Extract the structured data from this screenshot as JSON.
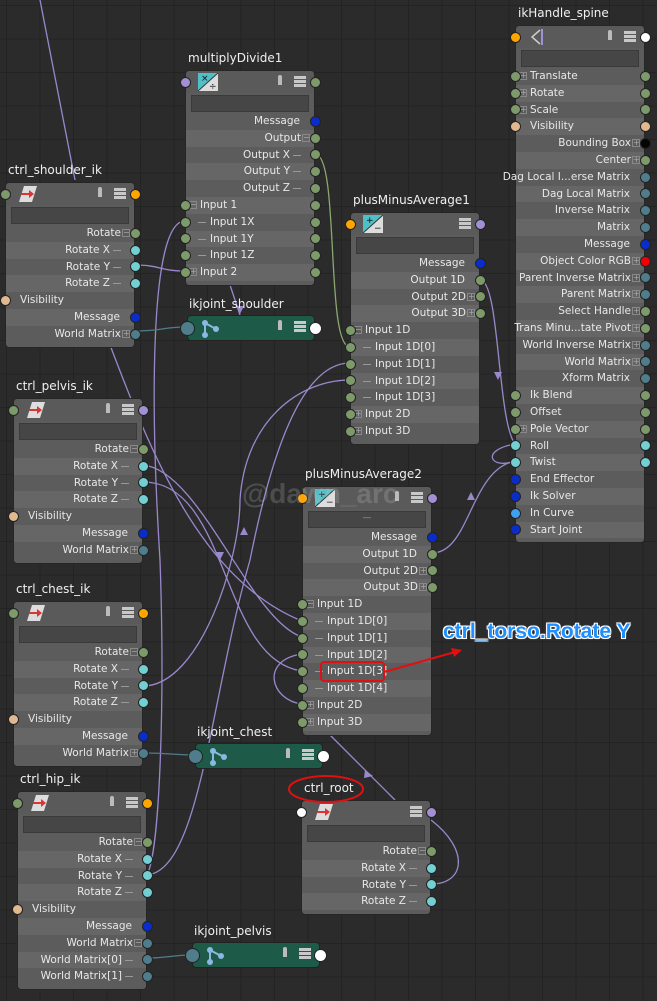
{
  "port_colors": {
    "green": "#7d9a6a",
    "teal": "#72cfd2",
    "blue": "#0a2cc8",
    "orange": "#ffa500",
    "purple": "#a28fd4",
    "tan": "#e0b990",
    "steel": "#4f7d8c",
    "black": "#050505",
    "red": "#f00000",
    "lightblue": "#3fa0f0",
    "white": "#ffffff"
  },
  "nodes": [
    {
      "id": "md1",
      "name": "multiplyDivide1",
      "icon": "multiply-divide",
      "hl": "purple",
      "hr": "green",
      "pin": true,
      "rows": [
        {
          "label": "Message",
          "a": "r",
          "r": "blue"
        },
        {
          "label": "Output",
          "a": "r",
          "x": "−",
          "r": "green"
        },
        {
          "label": "Output X",
          "a": "r",
          "c": 1,
          "r": "green"
        },
        {
          "label": "Output Y",
          "a": "r",
          "c": 1,
          "r": "green"
        },
        {
          "label": "Output Z",
          "a": "r",
          "c": 1,
          "r": "green"
        },
        {
          "label": "Input 1",
          "a": "l",
          "x": "−",
          "l": "green",
          "r": "green"
        },
        {
          "label": "Input 1X",
          "a": "l",
          "c": 1,
          "l": "green",
          "r": "green"
        },
        {
          "label": "Input 1Y",
          "a": "l",
          "c": 1,
          "l": "green",
          "r": "green"
        },
        {
          "label": "Input 1Z",
          "a": "l",
          "c": 1,
          "l": "green",
          "r": "green"
        },
        {
          "label": "Input 2",
          "a": "l",
          "x": "+",
          "l": "green",
          "r": "green"
        }
      ]
    },
    {
      "id": "sh",
      "name": "ctrl_shoulder_ik",
      "icon": "transform",
      "hl": "green",
      "hr": "orange",
      "pin": true,
      "rows": [
        {
          "label": "Rotate",
          "a": "r",
          "x": "−",
          "r": "green"
        },
        {
          "label": "Rotate X",
          "a": "r",
          "c": 1,
          "r": "teal"
        },
        {
          "label": "Rotate Y",
          "a": "r",
          "c": 1,
          "r": "teal"
        },
        {
          "label": "Rotate Z",
          "a": "r",
          "c": 1,
          "r": "teal"
        },
        {
          "label": "Visibility",
          "a": "l",
          "l": "tan"
        },
        {
          "label": "Message",
          "a": "r",
          "r": "blue"
        },
        {
          "label": "World Matrix",
          "a": "r",
          "x": "+",
          "r": "steel"
        }
      ]
    },
    {
      "id": "pma1",
      "name": "plusMinusAverage1",
      "icon": "plus-minus",
      "hl": "orange",
      "hr": "purple",
      "pin": false,
      "rows": [
        {
          "label": "Message",
          "a": "r",
          "r": "blue"
        },
        {
          "label": "Output 1D",
          "a": "r",
          "r": "green"
        },
        {
          "label": "Output 2D",
          "a": "r",
          "x": "+",
          "r": "green"
        },
        {
          "label": "Output 3D",
          "a": "r",
          "x": "+",
          "r": "green"
        },
        {
          "label": "Input 1D",
          "a": "l",
          "x": "−",
          "l": "green"
        },
        {
          "label": "Input 1D[0]",
          "a": "l",
          "c": 1,
          "l": "green"
        },
        {
          "label": "Input 1D[1]",
          "a": "l",
          "c": 1,
          "l": "green"
        },
        {
          "label": "Input 1D[2]",
          "a": "l",
          "c": 1,
          "l": "green"
        },
        {
          "label": "Input 1D[3]",
          "a": "l",
          "c": 1,
          "l": "green"
        },
        {
          "label": "Input 2D",
          "a": "l",
          "x": "+",
          "l": "green"
        },
        {
          "label": "Input 3D",
          "a": "l",
          "x": "+",
          "l": "green"
        }
      ]
    },
    {
      "id": "ikh",
      "name": "ikHandle_spine",
      "icon": "ik-handle",
      "hl": "orange",
      "hr": "white",
      "pin": true,
      "rows": [
        {
          "label": "Translate",
          "a": "l",
          "x": "+",
          "l": "green",
          "r": "green"
        },
        {
          "label": "Rotate",
          "a": "l",
          "x": "+",
          "l": "green",
          "r": "green"
        },
        {
          "label": "Scale",
          "a": "l",
          "x": "+",
          "l": "green",
          "r": "green"
        },
        {
          "label": "Visibility",
          "a": "l",
          "l": "tan",
          "r": "tan"
        },
        {
          "label": "Bounding Box",
          "a": "r",
          "x": "+",
          "r": "black"
        },
        {
          "label": "Center",
          "a": "r",
          "x": "+",
          "r": "green"
        },
        {
          "label": "Dag Local I...erse Matrix",
          "a": "r",
          "r": "steel"
        },
        {
          "label": "Dag Local Matrix",
          "a": "r",
          "r": "steel"
        },
        {
          "label": "Inverse Matrix",
          "a": "r",
          "r": "steel"
        },
        {
          "label": "Matrix",
          "a": "r",
          "r": "steel"
        },
        {
          "label": "Message",
          "a": "r",
          "r": "blue"
        },
        {
          "label": "Object Color RGB",
          "a": "r",
          "x": "+",
          "r": "red"
        },
        {
          "label": "Parent Inverse Matrix",
          "a": "r",
          "x": "+",
          "r": "steel"
        },
        {
          "label": "Parent Matrix",
          "a": "r",
          "x": "+",
          "r": "steel"
        },
        {
          "label": "Select Handle",
          "a": "r",
          "x": "+",
          "r": "green"
        },
        {
          "label": "Trans Minu...tate Pivot",
          "a": "r",
          "x": "+",
          "r": "green"
        },
        {
          "label": "World Inverse Matrix",
          "a": "r",
          "x": "+",
          "r": "steel"
        },
        {
          "label": "World Matrix",
          "a": "r",
          "x": "+",
          "r": "steel"
        },
        {
          "label": "Xform Matrix",
          "a": "r",
          "r": "steel"
        },
        {
          "label": "Ik Blend",
          "a": "l",
          "l": "green",
          "r": "green"
        },
        {
          "label": "Offset",
          "a": "l",
          "l": "green",
          "r": "green"
        },
        {
          "label": "Pole Vector",
          "a": "l",
          "x": "+",
          "l": "green",
          "r": "green"
        },
        {
          "label": "Roll",
          "a": "l",
          "l": "teal",
          "r": "teal"
        },
        {
          "label": "Twist",
          "a": "l",
          "l": "teal",
          "r": "teal"
        },
        {
          "label": "End Effector",
          "a": "l",
          "l": "blue"
        },
        {
          "label": "Ik Solver",
          "a": "l",
          "l": "blue"
        },
        {
          "label": "In Curve",
          "a": "l",
          "l": "lightblue"
        },
        {
          "label": "Start Joint",
          "a": "l",
          "l": "blue"
        }
      ]
    },
    {
      "id": "pel",
      "name": "ctrl_pelvis_ik",
      "icon": "transform",
      "hl": "green",
      "hr": "purple",
      "pin": true,
      "rows": [
        {
          "label": "Rotate",
          "a": "r",
          "x": "−",
          "r": "green"
        },
        {
          "label": "Rotate X",
          "a": "r",
          "c": 1,
          "r": "teal"
        },
        {
          "label": "Rotate Y",
          "a": "r",
          "c": 1,
          "r": "teal"
        },
        {
          "label": "Rotate Z",
          "a": "r",
          "c": 1,
          "r": "teal"
        },
        {
          "label": "Visibility",
          "a": "l",
          "l": "tan"
        },
        {
          "label": "Message",
          "a": "r",
          "r": "blue"
        },
        {
          "label": "World Matrix",
          "a": "r",
          "x": "+",
          "r": "steel"
        }
      ]
    },
    {
      "id": "pma2",
      "name": "plusMinusAverage2",
      "icon": "plus-minus",
      "hl": "orange",
      "hr": "purple",
      "pin": true,
      "field": "—",
      "rows": [
        {
          "label": "Message",
          "a": "r",
          "r": "blue"
        },
        {
          "label": "Output 1D",
          "a": "r",
          "r": "green"
        },
        {
          "label": "Output 2D",
          "a": "r",
          "x": "+",
          "r": "green"
        },
        {
          "label": "Output 3D",
          "a": "r",
          "x": "+",
          "r": "green"
        },
        {
          "label": "Input 1D",
          "a": "l",
          "x": "−",
          "l": "green"
        },
        {
          "label": "Input 1D[0]",
          "a": "l",
          "c": 1,
          "l": "green"
        },
        {
          "label": "Input 1D[1]",
          "a": "l",
          "c": 1,
          "l": "green"
        },
        {
          "label": "Input 1D[2]",
          "a": "l",
          "c": 1,
          "l": "green"
        },
        {
          "label": "Input 1D[3]",
          "a": "l",
          "c": 1,
          "l": "green"
        },
        {
          "label": "Input 1D[4]",
          "a": "l",
          "c": 1,
          "l": "green"
        },
        {
          "label": "Input 2D",
          "a": "l",
          "x": "+",
          "l": "green"
        },
        {
          "label": "Input 3D",
          "a": "l",
          "x": "+",
          "l": "green"
        }
      ]
    },
    {
      "id": "chest",
      "name": "ctrl_chest_ik",
      "icon": "transform",
      "hl": "green",
      "hr": "orange",
      "pin": true,
      "rows": [
        {
          "label": "Rotate",
          "a": "r",
          "x": "−",
          "r": "green"
        },
        {
          "label": "Rotate X",
          "a": "r",
          "c": 1,
          "r": "teal"
        },
        {
          "label": "Rotate Y",
          "a": "r",
          "c": 1,
          "r": "teal"
        },
        {
          "label": "Rotate Z",
          "a": "r",
          "c": 1,
          "r": "teal"
        },
        {
          "label": "Visibility",
          "a": "l",
          "l": "tan"
        },
        {
          "label": "Message",
          "a": "r",
          "r": "blue"
        },
        {
          "label": "World Matrix",
          "a": "r",
          "x": "+",
          "r": "steel"
        }
      ]
    },
    {
      "id": "hip",
      "name": "ctrl_hip_ik",
      "icon": "transform",
      "hl": "green",
      "hr": "orange",
      "pin": true,
      "rows": [
        {
          "label": "Rotate",
          "a": "r",
          "x": "−",
          "r": "green"
        },
        {
          "label": "Rotate X",
          "a": "r",
          "c": 1,
          "r": "teal"
        },
        {
          "label": "Rotate Y",
          "a": "r",
          "c": 1,
          "r": "teal"
        },
        {
          "label": "Rotate Z",
          "a": "r",
          "c": 1,
          "r": "teal"
        },
        {
          "label": "Visibility",
          "a": "l",
          "l": "tan"
        },
        {
          "label": "Message",
          "a": "r",
          "r": "blue"
        },
        {
          "label": "World Matrix",
          "a": "r",
          "x": "−",
          "r": "steel"
        },
        {
          "label": "World Matrix[0]",
          "a": "r",
          "c": 1,
          "r": "steel"
        },
        {
          "label": "World Matrix[1]",
          "a": "r",
          "c": 1,
          "r": "steel"
        }
      ]
    },
    {
      "id": "root",
      "name": "ctrl_root",
      "icon": "transform",
      "hl": "white",
      "hr": "purple",
      "pin": false,
      "rows": [
        {
          "label": "Rotate",
          "a": "r",
          "x": "−",
          "r": "green"
        },
        {
          "label": "Rotate X",
          "a": "r",
          "c": 1,
          "r": "teal"
        },
        {
          "label": "Rotate Y",
          "a": "r",
          "c": 1,
          "r": "teal"
        },
        {
          "label": "Rotate Z",
          "a": "r",
          "c": 1,
          "r": "teal"
        }
      ]
    }
  ],
  "joints": [
    {
      "id": "js",
      "name": "ikjoint_shoulder"
    },
    {
      "id": "jc",
      "name": "ikjoint_chest"
    },
    {
      "id": "jp",
      "name": "ikjoint_pelvis"
    }
  ],
  "annotation": {
    "text": "ctrl_torso.Rotate Y",
    "highlighted_row": "plusMinusAverage2.Input 1D[3]",
    "circled_title": "ctrl_root",
    "color": "#1e8fff",
    "marker_color": "#e01010"
  },
  "watermark": "@dawn_arc"
}
